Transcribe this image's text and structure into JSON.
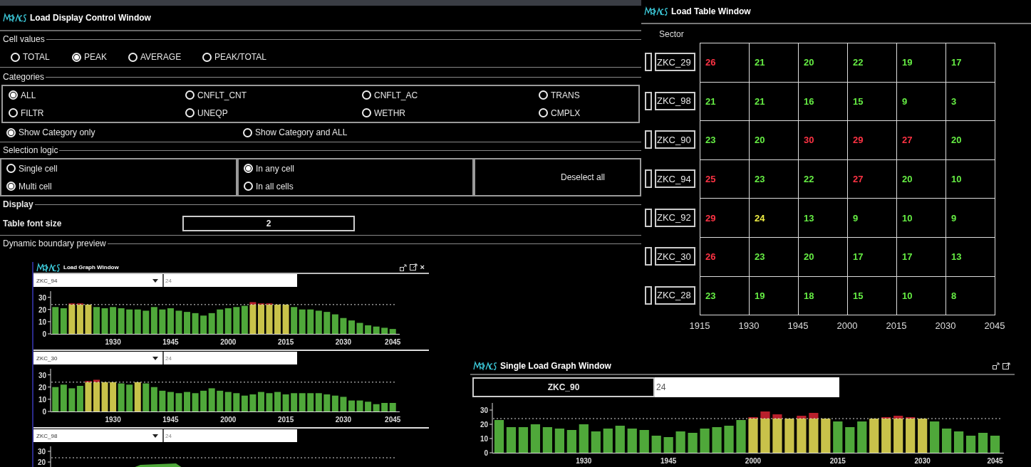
{
  "control_window": {
    "title": "Load Display Control Window",
    "cell_values": {
      "label": "Cell values",
      "options": [
        {
          "label": "TOTAL",
          "selected": false
        },
        {
          "label": "PEAK",
          "selected": true
        },
        {
          "label": "AVERAGE",
          "selected": false
        },
        {
          "label": "PEAK/TOTAL",
          "selected": false
        }
      ]
    },
    "categories": {
      "label": "Categories",
      "options": [
        {
          "label": "ALL",
          "selected": true
        },
        {
          "label": "CNFLT_CNT",
          "selected": false
        },
        {
          "label": "CNFLT_AC",
          "selected": false
        },
        {
          "label": "TRANS",
          "selected": false
        },
        {
          "label": "FILTR",
          "selected": false
        },
        {
          "label": "UNEQP",
          "selected": false
        },
        {
          "label": "WETHR",
          "selected": false
        },
        {
          "label": "CMPLX",
          "selected": false
        }
      ],
      "show_modes": [
        {
          "label": "Show Category only",
          "selected": true
        },
        {
          "label": "Show Category and ALL",
          "selected": false
        }
      ]
    },
    "selection_logic": {
      "label": "Selection logic",
      "cell_modes": [
        {
          "label": "Single cell",
          "selected": false
        },
        {
          "label": "Multi cell",
          "selected": true
        }
      ],
      "match_modes": [
        {
          "label": "In any cell",
          "selected": true
        },
        {
          "label": "In all cells",
          "selected": false
        }
      ],
      "deselect_button": "Deselect all"
    },
    "display": {
      "label": "Display",
      "font_size_label": "Table font size",
      "font_size_value": "2"
    },
    "next_section": "Dynamic boundary preview"
  },
  "table_window": {
    "title": "Load Table Window",
    "row_header": "Sector",
    "rows": [
      {
        "sector": "ZKC_29",
        "checked": false,
        "cells": [
          {
            "value": "26",
            "color": "#ff3344"
          },
          {
            "value": "21",
            "color": "#66ee44"
          },
          {
            "value": "20",
            "color": "#66ee44"
          },
          {
            "value": "22",
            "color": "#66ee44"
          },
          {
            "value": "19",
            "color": "#66ee44"
          },
          {
            "value": "17",
            "color": "#66ee44"
          }
        ]
      },
      {
        "sector": "ZKC_98",
        "checked": false,
        "cells": [
          {
            "value": "21",
            "color": "#66ee44"
          },
          {
            "value": "21",
            "color": "#66ee44"
          },
          {
            "value": "16",
            "color": "#66ee44"
          },
          {
            "value": "15",
            "color": "#66ee44"
          },
          {
            "value": "9",
            "color": "#66ee44"
          },
          {
            "value": "3",
            "color": "#66ee44"
          }
        ]
      },
      {
        "sector": "ZKC_90",
        "checked": false,
        "cells": [
          {
            "value": "23",
            "color": "#66ee44"
          },
          {
            "value": "20",
            "color": "#66ee44"
          },
          {
            "value": "30",
            "color": "#ff3344"
          },
          {
            "value": "29",
            "color": "#ff3344"
          },
          {
            "value": "27",
            "color": "#ff3344"
          },
          {
            "value": "20",
            "color": "#66ee44"
          }
        ]
      },
      {
        "sector": "ZKC_94",
        "checked": false,
        "cells": [
          {
            "value": "25",
            "color": "#ff3344"
          },
          {
            "value": "23",
            "color": "#66ee44"
          },
          {
            "value": "22",
            "color": "#66ee44"
          },
          {
            "value": "27",
            "color": "#ff3344"
          },
          {
            "value": "20",
            "color": "#66ee44"
          },
          {
            "value": "10",
            "color": "#66ee44"
          }
        ]
      },
      {
        "sector": "ZKC_92",
        "checked": false,
        "cells": [
          {
            "value": "29",
            "color": "#ff3344"
          },
          {
            "value": "24",
            "color": "#eeee44"
          },
          {
            "value": "13",
            "color": "#66ee44"
          },
          {
            "value": "9",
            "color": "#66ee44"
          },
          {
            "value": "10",
            "color": "#66ee44"
          },
          {
            "value": "9",
            "color": "#66ee44"
          }
        ]
      },
      {
        "sector": "ZKC_30",
        "checked": false,
        "cells": [
          {
            "value": "26",
            "color": "#ff3344"
          },
          {
            "value": "23",
            "color": "#66ee44"
          },
          {
            "value": "20",
            "color": "#66ee44"
          },
          {
            "value": "17",
            "color": "#66ee44"
          },
          {
            "value": "17",
            "color": "#66ee44"
          },
          {
            "value": "13",
            "color": "#66ee44"
          }
        ]
      },
      {
        "sector": "ZKC_28",
        "checked": false,
        "cells": [
          {
            "value": "23",
            "color": "#66ee44"
          },
          {
            "value": "19",
            "color": "#66ee44"
          },
          {
            "value": "18",
            "color": "#66ee44"
          },
          {
            "value": "15",
            "color": "#66ee44"
          },
          {
            "value": "10",
            "color": "#66ee44"
          },
          {
            "value": "8",
            "color": "#66ee44"
          }
        ]
      }
    ],
    "time_labels": [
      "1915",
      "1930",
      "1945",
      "2000",
      "2015",
      "2030",
      "2045"
    ]
  },
  "graph_window": {
    "title": "Load Graph Window",
    "close": "×",
    "panels": [
      {
        "sector": "ZKC_94",
        "threshold": "24",
        "chart_data": {
          "type": "bar",
          "stacked": true,
          "categories": [
            null,
            null,
            null,
            null,
            null,
            null,
            null,
            "1930",
            null,
            null,
            null,
            null,
            null,
            null,
            "1945",
            null,
            null,
            null,
            null,
            null,
            null,
            "2000",
            null,
            null,
            null,
            null,
            null,
            null,
            "2015",
            null,
            null,
            null,
            null,
            null,
            null,
            "2030",
            null,
            null,
            null,
            null,
            null,
            "2045"
          ],
          "ylim": [
            0,
            35
          ],
          "yticks": [
            0,
            10,
            20,
            30
          ],
          "ref_lines": [
            {
              "axis": "y",
              "value": 24
            }
          ],
          "series": [
            {
              "color": "#4fa83a",
              "values": [
                22,
                21,
                null,
                null,
                null,
                22,
                21,
                22,
                21,
                20,
                20,
                19,
                22,
                20,
                21,
                19,
                18,
                17,
                15,
                17,
                20,
                21,
                22,
                23,
                null,
                null,
                null,
                null,
                null,
                22,
                20,
                20,
                19,
                18,
                16,
                13,
                11,
                9,
                7,
                6,
                5,
                4
              ]
            },
            {
              "color": "#c9c24a",
              "values": [
                null,
                null,
                24,
                24,
                24,
                null,
                null,
                null,
                null,
                null,
                null,
                null,
                null,
                null,
                null,
                null,
                null,
                null,
                null,
                null,
                null,
                null,
                null,
                null,
                24,
                24,
                24,
                24,
                24,
                null,
                null,
                null,
                null,
                null,
                null,
                null,
                null,
                null,
                null,
                null,
                null,
                null
              ]
            },
            {
              "color": "#b8202c",
              "values": [
                null,
                null,
                1,
                1,
                null,
                null,
                null,
                null,
                null,
                null,
                null,
                null,
                null,
                null,
                null,
                null,
                null,
                null,
                null,
                null,
                null,
                null,
                null,
                null,
                2,
                1,
                1,
                null,
                null,
                null,
                null,
                null,
                null,
                null,
                null,
                null,
                null,
                null,
                null,
                null,
                null,
                null
              ]
            }
          ]
        }
      },
      {
        "sector": "ZKC_30",
        "threshold": "24",
        "chart_data": {
          "type": "bar",
          "stacked": true,
          "categories": [
            null,
            null,
            null,
            null,
            null,
            null,
            null,
            "1930",
            null,
            null,
            null,
            null,
            null,
            null,
            "1945",
            null,
            null,
            null,
            null,
            null,
            null,
            "2000",
            null,
            null,
            null,
            null,
            null,
            null,
            "2015",
            null,
            null,
            null,
            null,
            null,
            null,
            "2030",
            null,
            null,
            null,
            null,
            null,
            "2045"
          ],
          "ylim": [
            0,
            35
          ],
          "yticks": [
            0,
            10,
            20,
            30
          ],
          "ref_lines": [
            {
              "axis": "y",
              "value": 24
            }
          ],
          "series": [
            {
              "color": "#4fa83a",
              "values": [
                20,
                22,
                19,
                21,
                null,
                null,
                null,
                null,
                23,
                22,
                null,
                23,
                20,
                17,
                16,
                15,
                16,
                15,
                17,
                19,
                17,
                16,
                15,
                13,
                14,
                16,
                15,
                16,
                14,
                15,
                15,
                15,
                15,
                14,
                13,
                12,
                9,
                9,
                8,
                6,
                7,
                7
              ]
            },
            {
              "color": "#c9c24a",
              "values": [
                null,
                null,
                null,
                null,
                24,
                24,
                24,
                24,
                null,
                null,
                24,
                null,
                null,
                null,
                null,
                null,
                null,
                null,
                null,
                null,
                null,
                null,
                null,
                null,
                null,
                null,
                null,
                null,
                null,
                null,
                null,
                null,
                null,
                null,
                null,
                null,
                null,
                null,
                null,
                null,
                null,
                null
              ]
            },
            {
              "color": "#b8202c",
              "values": [
                null,
                null,
                null,
                null,
                1,
                2,
                null,
                null,
                null,
                null,
                null,
                null,
                null,
                null,
                null,
                null,
                null,
                null,
                null,
                null,
                null,
                null,
                null,
                null,
                null,
                null,
                null,
                null,
                null,
                null,
                null,
                null,
                null,
                null,
                null,
                null,
                null,
                null,
                null,
                null,
                null,
                null
              ]
            }
          ]
        }
      },
      {
        "sector": "ZKC_98",
        "threshold": "24",
        "axis_labels": [
          "30",
          "20"
        ]
      }
    ]
  },
  "single_window": {
    "title": "Single Load Graph Window",
    "sector": "ZKC_90",
    "threshold": "24",
    "chart_data": {
      "type": "bar",
      "stacked": true,
      "categories": [
        null,
        null,
        null,
        null,
        null,
        null,
        null,
        "1930",
        null,
        null,
        null,
        null,
        null,
        null,
        "1945",
        null,
        null,
        null,
        null,
        null,
        null,
        "2000",
        null,
        null,
        null,
        null,
        null,
        null,
        "2015",
        null,
        null,
        null,
        null,
        null,
        null,
        "2030",
        null,
        null,
        null,
        null,
        null,
        "2045"
      ],
      "ylim": [
        0,
        35
      ],
      "yticks": [
        0,
        10,
        20,
        30
      ],
      "ref_lines": [
        {
          "axis": "y",
          "value": 24
        }
      ],
      "series": [
        {
          "color": "#4fa83a",
          "values": [
            23,
            18,
            18,
            20,
            18,
            17,
            16,
            20,
            15,
            17,
            19,
            17,
            16,
            12,
            11,
            15,
            14,
            17,
            18,
            19,
            23,
            null,
            null,
            null,
            null,
            null,
            null,
            null,
            22,
            18,
            22,
            null,
            null,
            null,
            null,
            null,
            22,
            17,
            15,
            12,
            14,
            12
          ]
        },
        {
          "color": "#c9c24a",
          "values": [
            null,
            null,
            null,
            null,
            null,
            null,
            null,
            null,
            null,
            null,
            null,
            null,
            null,
            null,
            null,
            null,
            null,
            null,
            null,
            null,
            null,
            24,
            24,
            24,
            24,
            24,
            24,
            24,
            null,
            null,
            null,
            24,
            24,
            24,
            24,
            24,
            null,
            null,
            null,
            null,
            null,
            null
          ]
        },
        {
          "color": "#b8202c",
          "values": [
            null,
            null,
            null,
            null,
            null,
            null,
            null,
            null,
            null,
            null,
            null,
            null,
            null,
            null,
            null,
            null,
            null,
            null,
            null,
            null,
            null,
            1,
            5,
            3,
            null,
            2,
            4,
            null,
            null,
            null,
            null,
            null,
            1,
            2,
            1,
            null,
            null,
            null,
            null,
            null,
            null,
            null
          ]
        }
      ]
    }
  }
}
